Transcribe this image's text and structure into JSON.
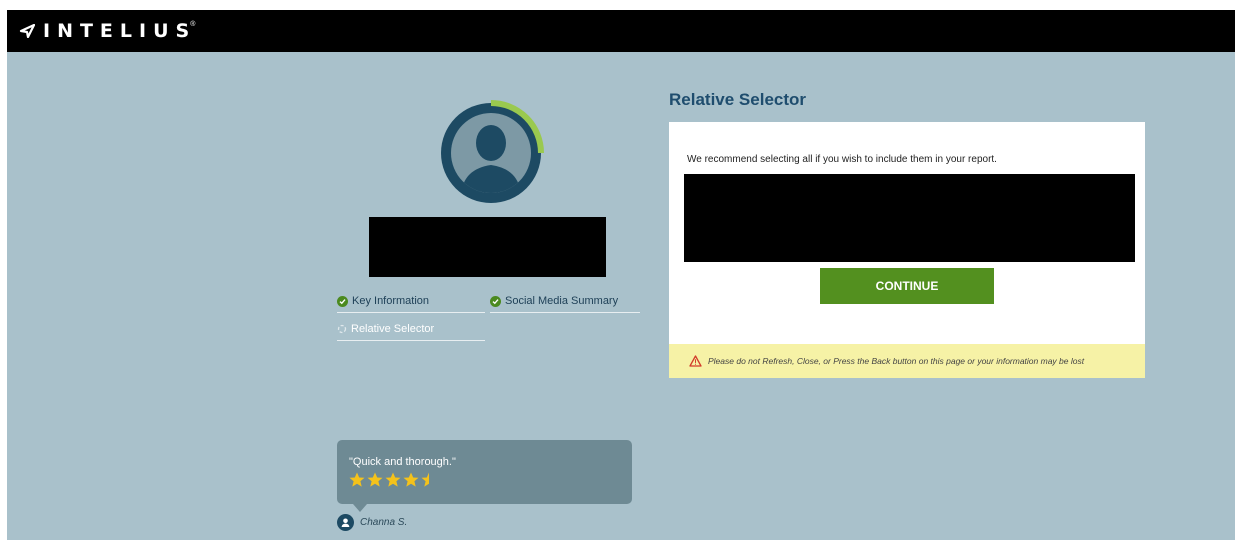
{
  "brand": {
    "name": "INTELIUS",
    "trademark": "®",
    "logo_icon": "check-arrow-icon"
  },
  "colors": {
    "topbar": "#000000",
    "background": "#a9c1cb",
    "accent_green": "#53901f",
    "progress_ring": "#9ac94f",
    "title": "#1f4d6e",
    "warning_bg": "#f6f2a6",
    "testimonial_bg": "#6e8a94"
  },
  "profile": {
    "avatar_icon": "person-silhouette-icon",
    "progress": 0.25
  },
  "steps": [
    {
      "label": "Key Information",
      "status": "complete",
      "icon": "check-circle-icon"
    },
    {
      "label": "Social Media Summary",
      "status": "complete",
      "icon": "check-circle-icon"
    },
    {
      "label": "Relative Selector",
      "status": "active",
      "icon": "spinner-icon"
    }
  ],
  "selector": {
    "title": "Relative Selector",
    "instruction": "We recommend selecting all if you wish to include them in your report.",
    "continue_label": "CONTINUE",
    "warning": "Please do not Refresh, Close, or Press the Back button on this page or your information may be lost",
    "warning_icon": "warning-triangle-icon"
  },
  "testimonial": {
    "quote": "\"Quick and thorough.\"",
    "rating": 4.5,
    "max_rating": 5,
    "reviewer": "Channa S.",
    "reviewer_icon": "user-icon"
  }
}
